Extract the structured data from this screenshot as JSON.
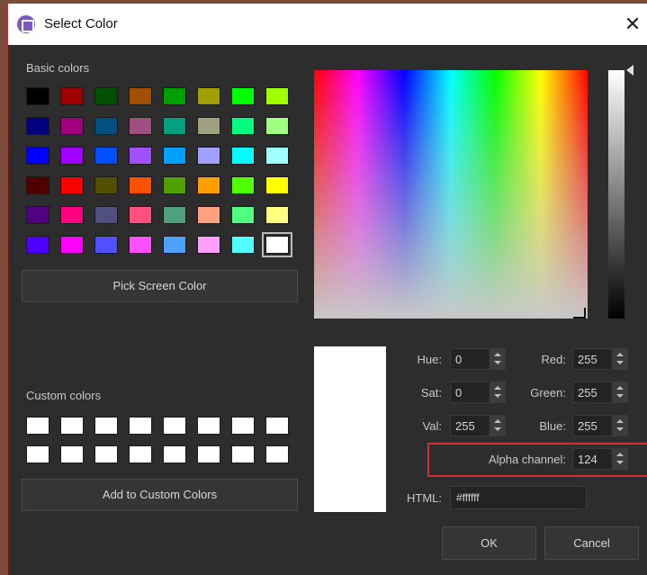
{
  "window": {
    "title": "Select Color",
    "close_glyph": "✕"
  },
  "basic_colors": {
    "label": "Basic colors",
    "swatches": [
      "#000000",
      "#a00000",
      "#005000",
      "#a05000",
      "#00a000",
      "#a0a000",
      "#00ff00",
      "#a0ff00",
      "#000080",
      "#a00080",
      "#005080",
      "#a05080",
      "#00a080",
      "#a0a080",
      "#00ff80",
      "#a0ff80",
      "#0000ff",
      "#a000ff",
      "#0050ff",
      "#a050ff",
      "#00a0ff",
      "#a0a0ff",
      "#00ffff",
      "#a0ffff",
      "#500000",
      "#ff0000",
      "#505000",
      "#ff5000",
      "#50a000",
      "#ffa000",
      "#50ff00",
      "#ffff00",
      "#500080",
      "#ff0080",
      "#505080",
      "#ff5080",
      "#50a080",
      "#ffa080",
      "#50ff80",
      "#ffff80",
      "#5000ff",
      "#ff00ff",
      "#5050ff",
      "#ff50ff",
      "#50a0ff",
      "#ffa0ff",
      "#50ffff",
      "#ffffff"
    ],
    "selected_index": 47
  },
  "pick_screen_label": "Pick Screen Color",
  "custom_colors": {
    "label": "Custom colors",
    "swatches": [
      "#ffffff",
      "#ffffff",
      "#ffffff",
      "#ffffff",
      "#ffffff",
      "#ffffff",
      "#ffffff",
      "#ffffff",
      "#ffffff",
      "#ffffff",
      "#ffffff",
      "#ffffff",
      "#ffffff",
      "#ffffff",
      "#ffffff",
      "#ffffff"
    ]
  },
  "add_custom_label": "Add to Custom Colors",
  "fields": {
    "hue": {
      "label": "Hue:",
      "value": "0"
    },
    "sat": {
      "label": "Sat:",
      "value": "0"
    },
    "val": {
      "label": "Val:",
      "value": "255"
    },
    "red": {
      "label": "Red:",
      "value": "255"
    },
    "green": {
      "label": "Green:",
      "value": "255"
    },
    "blue": {
      "label": "Blue:",
      "value": "255"
    },
    "alpha": {
      "label": "Alpha channel:",
      "value": "124"
    },
    "html": {
      "label": "HTML:",
      "value": "#ffffff"
    }
  },
  "buttons": {
    "ok": "OK",
    "cancel": "Cancel"
  },
  "colors": {
    "highlight": "#d32f2f",
    "preview": "#ffffff"
  }
}
